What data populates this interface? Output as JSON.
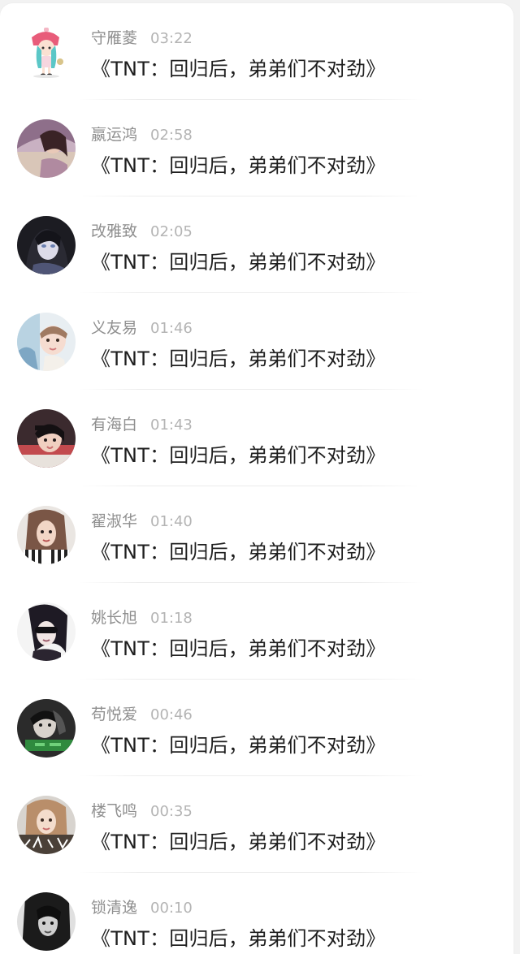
{
  "items": [
    {
      "name": "守雁菱",
      "time": "03:22",
      "title": "《TNT：回归后，弟弟们不对劲》",
      "avatar": "avatar-cartoon-girl-icon"
    },
    {
      "name": "嬴运鸿",
      "time": "02:58",
      "title": "《TNT：回归后，弟弟们不对劲》",
      "avatar": "avatar-photo-icon"
    },
    {
      "name": "改雅致",
      "time": "02:05",
      "title": "《TNT：回归后，弟弟们不对劲》",
      "avatar": "avatar-photo-icon"
    },
    {
      "name": "义友易",
      "time": "01:46",
      "title": "《TNT：回归后，弟弟们不对劲》",
      "avatar": "avatar-photo-icon"
    },
    {
      "name": "有海白",
      "time": "01:43",
      "title": "《TNT：回归后，弟弟们不对劲》",
      "avatar": "avatar-photo-icon"
    },
    {
      "name": "翟淑华",
      "time": "01:40",
      "title": "《TNT：回归后，弟弟们不对劲》",
      "avatar": "avatar-photo-icon"
    },
    {
      "name": "姚长旭",
      "time": "01:18",
      "title": "《TNT：回归后，弟弟们不对劲》",
      "avatar": "avatar-photo-icon"
    },
    {
      "name": "苟悦爱",
      "time": "00:46",
      "title": "《TNT：回归后，弟弟们不对劲》",
      "avatar": "avatar-photo-icon"
    },
    {
      "name": "楼飞鸣",
      "time": "00:35",
      "title": "《TNT：回归后，弟弟们不对劲》",
      "avatar": "avatar-photo-icon"
    },
    {
      "name": "锁清逸",
      "time": "00:10",
      "title": "《TNT：回归后，弟弟们不对劲》",
      "avatar": "avatar-photo-icon"
    }
  ],
  "colors": {
    "name_text": "#8f8f8f",
    "time_text": "#b4b4b4",
    "title_text": "#1f1f1f",
    "background": "#ffffff"
  }
}
